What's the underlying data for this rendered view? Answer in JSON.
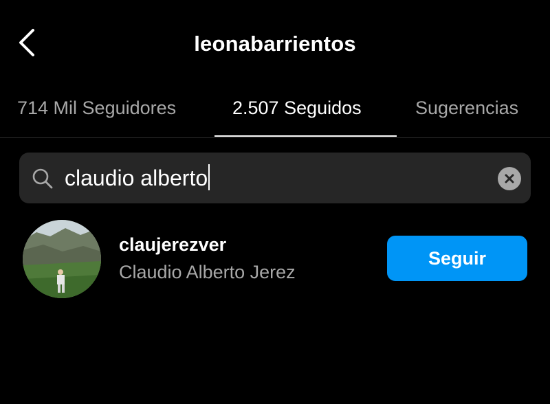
{
  "header": {
    "title": "leonabarrientos",
    "back_icon": "chevron-left-icon"
  },
  "tabs": [
    {
      "label": "714 Mil Seguidores",
      "active": false
    },
    {
      "label": "2.507 Seguidos",
      "active": true
    },
    {
      "label": "Sugerencias",
      "active": false
    }
  ],
  "search": {
    "value": "claudio alberto",
    "icon": "search-icon",
    "clear_icon": "clear-icon"
  },
  "results": [
    {
      "username": "claujerezver",
      "full_name": "Claudio Alberto Jerez",
      "button_label": "Seguir"
    }
  ],
  "colors": {
    "background": "#000000",
    "primary_text": "#ffffff",
    "secondary_text": "#a8a8a8",
    "search_bg": "#262626",
    "accent": "#0095f6"
  }
}
